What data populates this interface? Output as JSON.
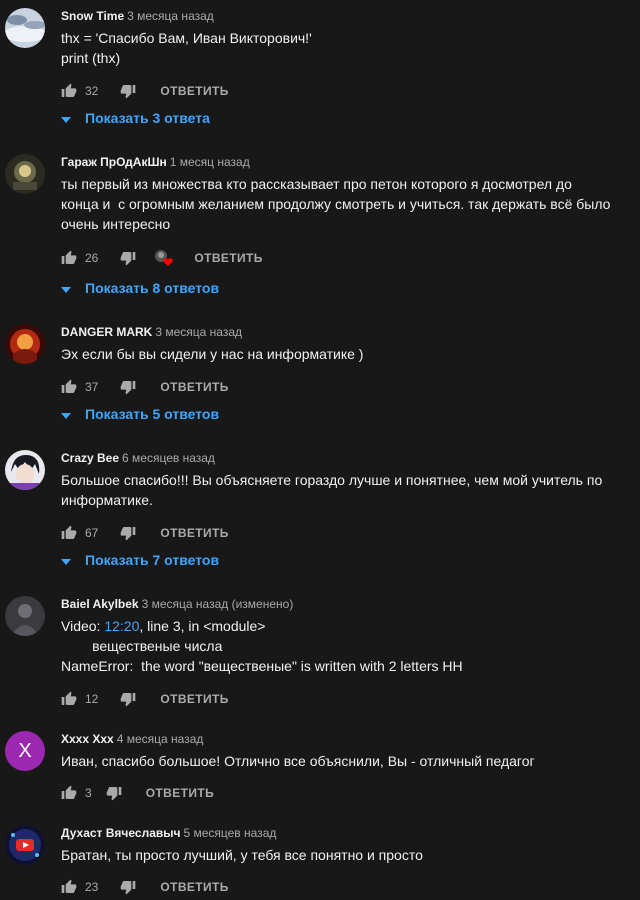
{
  "reply_label": "ОТВЕТИТЬ",
  "comments": [
    {
      "author": "Snow Time",
      "time": "3 месяца назад",
      "lines": [
        "thx = 'Спасибо Вам, Иван Викторович!'",
        "print (thx)"
      ],
      "likes": "32",
      "show_replies": "Показать 3 ответа"
    },
    {
      "author": "Гараж ПрОдАкШн",
      "time": "1 месяц назад",
      "lines": [
        "ты первый из множества кто рассказывает про петон которого я досмотрел до",
        "конца и  с огромным желанием продолжу смотреть и учиться. так держать всё было",
        "очень интересно"
      ],
      "likes": "26",
      "show_replies": "Показать 8 ответов"
    },
    {
      "author": "DANGER MARK",
      "time": "3 месяца назад",
      "lines": [
        "Эх если бы вы сидели у нас на информатике )"
      ],
      "likes": "37",
      "show_replies": "Показать 5 ответов"
    },
    {
      "author": "Crazy Bee",
      "time": "6 месяцев назад",
      "lines": [
        "Большое спасибо!!! Вы объясняете гораздо лучше и понятнее, чем мой учитель по",
        "информатике."
      ],
      "likes": "67",
      "show_replies": "Показать 7 ответов"
    },
    {
      "author": "Baiel Akylbek",
      "time": "3 месяца назад (изменено)",
      "line1_prefix": "Video: ",
      "line1_link": "12:20",
      "line1_suffix": ", line 3, in <module>",
      "lines": [
        "        вещественые числа",
        "NameError:  the word \"вещественые\" is written with 2 letters НН"
      ],
      "likes": "12"
    },
    {
      "author": "Хxxx Xxx",
      "time": "4 месяца назад",
      "avatar_letter": "X",
      "lines": [
        "Иван, спасибо большое! Отлично все объяснили, Вы - отличный педагог"
      ],
      "likes": "3"
    },
    {
      "author": "Духаст Вячеславыч",
      "time": "5 месяцев назад",
      "lines": [
        "Братан, ты просто лучший, у тебя все понятно и просто"
      ],
      "likes": "23"
    }
  ],
  "colors": {
    "background": "#181818",
    "text": "#f1f1f1",
    "secondary": "#aaaaaa",
    "link": "#3ea6ff",
    "avatar_purple": "#9c27b0",
    "heart": "#ff0000"
  },
  "icons": [
    "like-icon",
    "dislike-icon",
    "chevron-down-icon",
    "creator-heart-icon"
  ]
}
